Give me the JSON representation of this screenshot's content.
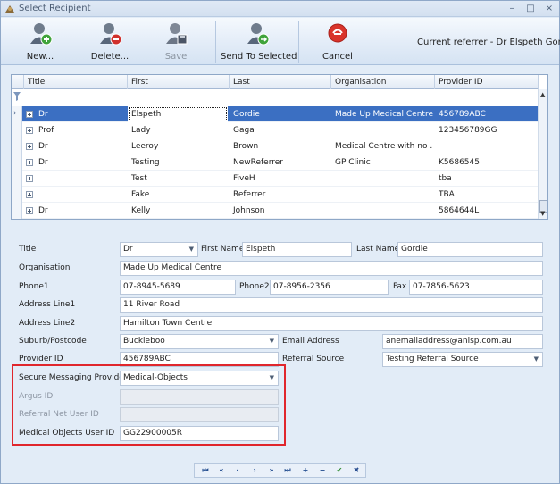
{
  "window": {
    "title": "Select Recipient",
    "controls": {
      "minimize": "–",
      "maximize": "□",
      "close": "×"
    }
  },
  "toolbar": {
    "new_label": "New...",
    "delete_label": "Delete...",
    "save_label": "Save",
    "send_label": "Send To Selected",
    "cancel_label": "Cancel",
    "current_referrer": "Current referrer - Dr Elspeth Gordie"
  },
  "grid": {
    "columns": [
      "Title",
      "First",
      "Last",
      "Organisation",
      "Provider ID"
    ],
    "rows": [
      {
        "title": "Dr",
        "first": "Elspeth",
        "last": "Gordie",
        "org": "Made Up Medical Centre",
        "provider_id": "456789ABC",
        "selected": true
      },
      {
        "title": "Prof",
        "first": "Lady",
        "last": "Gaga",
        "org": "",
        "provider_id": "123456789GG",
        "selected": false
      },
      {
        "title": "Dr",
        "first": "Leeroy",
        "last": "Brown",
        "org": "Medical Centre with no ...",
        "provider_id": "",
        "selected": false
      },
      {
        "title": "Dr",
        "first": "Testing",
        "last": "NewReferrer",
        "org": "GP Clinic",
        "provider_id": "K5686545",
        "selected": false
      },
      {
        "title": "",
        "first": "Test",
        "last": "FiveH",
        "org": "",
        "provider_id": "tba",
        "selected": false
      },
      {
        "title": "",
        "first": "Fake",
        "last": "Referrer",
        "org": "",
        "provider_id": "TBA",
        "selected": false
      },
      {
        "title": "Dr",
        "first": "Kelly",
        "last": "Johnson",
        "org": "",
        "provider_id": "5864644L",
        "selected": false
      }
    ]
  },
  "form": {
    "title_label": "Title",
    "title_value": "Dr",
    "first_name_label": "First Name",
    "first_name_value": "Elspeth",
    "last_name_label": "Last Name",
    "last_name_value": "Gordie",
    "organisation_label": "Organisation",
    "organisation_value": "Made Up Medical Centre",
    "phone1_label": "Phone1",
    "phone1_value": "07-8945-5689",
    "phone2_label": "Phone2",
    "phone2_value": "07-8956-2356",
    "fax_label": "Fax",
    "fax_value": "07-7856-5623",
    "address1_label": "Address Line1",
    "address1_value": "11 River Road",
    "address2_label": "Address Line2",
    "address2_value": "Hamilton Town Centre",
    "suburb_label": "Suburb/Postcode",
    "suburb_value": "Buckleboo",
    "email_label": "Email Address",
    "email_value": "anemailaddress@anisp.com.au",
    "provider_id_label": "Provider ID",
    "provider_id_value": "456789ABC",
    "referral_source_label": "Referral Source",
    "referral_source_value": "Testing Referral Source",
    "secure_msg_label": "Secure Messaging Provider",
    "secure_msg_value": "Medical-Objects",
    "argus_label": "Argus ID",
    "argus_value": "",
    "referral_net_label": "Referral Net User ID",
    "referral_net_value": "",
    "medical_objects_label": "Medical Objects User ID",
    "medical_objects_value": "GG22900005R"
  },
  "navigator": {
    "buttons": [
      "⏮",
      "«",
      "‹",
      "›",
      "»",
      "⏭",
      "+",
      "−",
      "✔",
      "✖"
    ]
  },
  "colors": {
    "selection": "#3b6fc2",
    "highlight_border": "#e0262c",
    "window_bg": "#e2ecf7"
  }
}
